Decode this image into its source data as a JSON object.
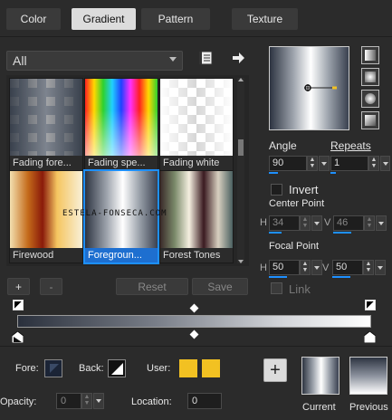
{
  "tabs": [
    "Color",
    "Gradient",
    "Pattern",
    "Texture"
  ],
  "category": {
    "value": "All"
  },
  "gallery": [
    {
      "label": "Fading fore..."
    },
    {
      "label": "Fading spe..."
    },
    {
      "label": "Fading white"
    },
    {
      "label": "Firewood"
    },
    {
      "label": "Foregroun..."
    },
    {
      "label": "Forest Tones"
    }
  ],
  "watermark": "ESTELA-FONSECA.COM",
  "gallery_buttons": {
    "add": "+",
    "remove": "-",
    "reset": "Reset",
    "save": "Save"
  },
  "angle": {
    "label": "Angle",
    "value": "90"
  },
  "repeats": {
    "label": "Repeats",
    "value": "1"
  },
  "invert": {
    "label": "Invert"
  },
  "center_point": {
    "label": "Center Point",
    "h_label": "H",
    "h_value": "34",
    "v_label": "V",
    "v_value": "46"
  },
  "focal_point": {
    "label": "Focal Point",
    "h_label": "H",
    "h_value": "50",
    "v_label": "V",
    "v_value": "50"
  },
  "link": {
    "label": "Link"
  },
  "bottom": {
    "fore_label": "Fore:",
    "back_label": "Back:",
    "user_label": "User:",
    "opacity_label": "Opacity:",
    "opacity_value": "0",
    "location_label": "Location:",
    "location_value": "0",
    "current_label": "Current",
    "previous_label": "Previous"
  },
  "colors": {
    "accent": "#1e90ff",
    "user_swatch": "#f2c122",
    "fore_swatch": "#1b2436"
  }
}
